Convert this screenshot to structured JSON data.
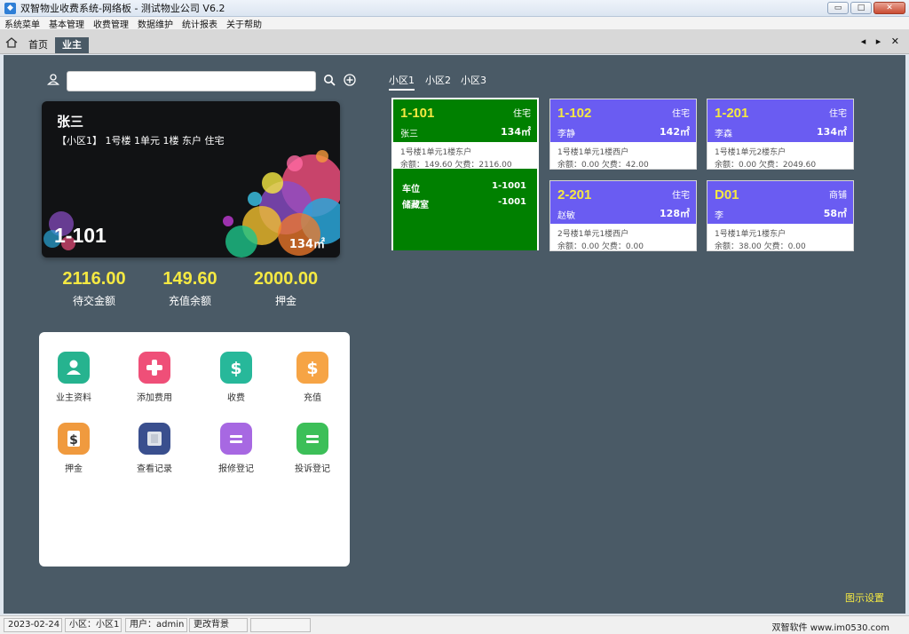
{
  "window": {
    "title": "双智物业收费系统-网络板 - 测试物业公司  V6.2",
    "buttons": {
      "minimize": "▭",
      "maximize": "□",
      "close": "✕"
    }
  },
  "menu": [
    "系统菜单",
    "基本管理",
    "收费管理",
    "数据维护",
    "统计报表",
    "关于帮助"
  ],
  "tabs": {
    "home": "首页",
    "active": "业主",
    "nav": "◂ ▸ ✕"
  },
  "search": {
    "value": "",
    "placeholder": ""
  },
  "owner_card": {
    "name": "张三",
    "address": "【小区1】 1号楼 1单元 1楼 东户 住宅",
    "unit": "1-101",
    "area": "134㎡"
  },
  "stats": [
    {
      "value": "2116.00",
      "label": "待交金额"
    },
    {
      "value": "149.60",
      "label": "充值余额"
    },
    {
      "value": "2000.00",
      "label": "押金"
    }
  ],
  "functions": [
    {
      "label": "业主资料",
      "icon": "user-icon",
      "color": "#26b38f"
    },
    {
      "label": "添加费用",
      "icon": "plus-icon",
      "color": "#ef4f78"
    },
    {
      "label": "收费",
      "icon": "dollar-icon",
      "color": "#27b89a"
    },
    {
      "label": "充值",
      "icon": "dollar-icon",
      "color": "#f6a445"
    },
    {
      "label": "押金",
      "icon": "dollar-icon",
      "color": "#f09a3e"
    },
    {
      "label": "查看记录",
      "icon": "record-icon",
      "color": "#3a4f8e"
    },
    {
      "label": "报修登记",
      "icon": "equal-icon",
      "color": "#a768e2"
    },
    {
      "label": "投诉登记",
      "icon": "equal-icon",
      "color": "#3cbf58"
    }
  ],
  "communities": [
    "小区1",
    "小区2",
    "小区3"
  ],
  "houses": [
    {
      "num": "1-101",
      "type": "住宅",
      "owner": "张三",
      "area": "134㎡",
      "desc": "1号楼1单元1楼东户",
      "balance": "余额：149.60  欠费：2116.00",
      "color": "#008000",
      "selected": true
    },
    {
      "num": "1-102",
      "type": "住宅",
      "owner": "李静",
      "area": "142㎡",
      "desc": "1号楼1单元1楼西户",
      "balance": "余额：0.00  欠费：42.00",
      "color": "#6a5cf2"
    },
    {
      "num": "1-201",
      "type": "住宅",
      "owner": "李森",
      "area": "134㎡",
      "desc": "1号楼1单元2楼东户",
      "balance": "余额：0.00  欠费：2049.60",
      "color": "#6a5cf2"
    },
    {
      "num": "2-201",
      "type": "住宅",
      "owner": "赵敏",
      "area": "128㎡",
      "desc": "2号楼1单元1楼西户",
      "balance": "余额：0.00  欠费：0.00",
      "color": "#6a5cf2"
    },
    {
      "num": "D01",
      "type": "商铺",
      "owner": "李",
      "area": "58㎡",
      "desc": "1号楼1单元1楼东户",
      "balance": "余额：38.00  欠费：0.00",
      "color": "#6a5cf2"
    }
  ],
  "selected_extras": [
    {
      "label": "车位",
      "value": "1-1001"
    },
    {
      "label": "储藏室",
      "value": "-1001"
    }
  ],
  "legend_link": "图示设置",
  "statusbar": {
    "date": "2023-02-24",
    "community": "小区：小区1",
    "user": "用户：admin",
    "background": "更改背景",
    "brand": "双智软件 www.im0530.com"
  }
}
